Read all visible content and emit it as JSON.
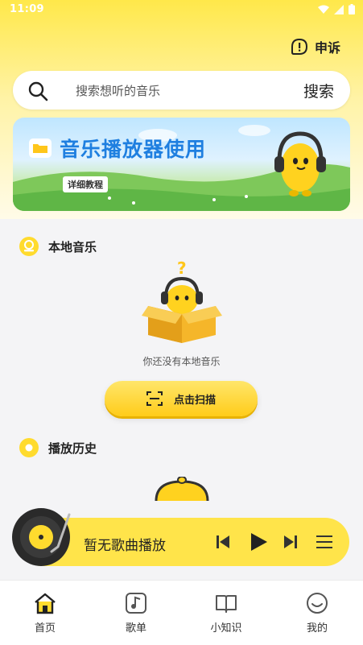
{
  "status_bar": {
    "time": "11:09"
  },
  "header": {
    "complaint_label": "申诉"
  },
  "search": {
    "placeholder": "搜索想听的音乐",
    "button_label": "搜索"
  },
  "banner": {
    "title": "音乐播放器使用",
    "tag": "详细教程"
  },
  "local_music": {
    "title": "本地音乐",
    "empty_text": "你还没有本地音乐",
    "scan_label": "点击扫描"
  },
  "history": {
    "title": "播放历史"
  },
  "player": {
    "title": "暂无歌曲播放"
  },
  "nav": {
    "items": [
      {
        "label": "首页",
        "icon": "home-icon",
        "active": true
      },
      {
        "label": "歌单",
        "icon": "music-note-icon",
        "active": false
      },
      {
        "label": "小知识",
        "icon": "book-icon",
        "active": false
      },
      {
        "label": "我的",
        "icon": "smile-icon",
        "active": false
      }
    ]
  },
  "colors": {
    "accent": "#ffe44a",
    "accent_dark": "#ffcc1a",
    "banner_title": "#1f7fe0"
  }
}
